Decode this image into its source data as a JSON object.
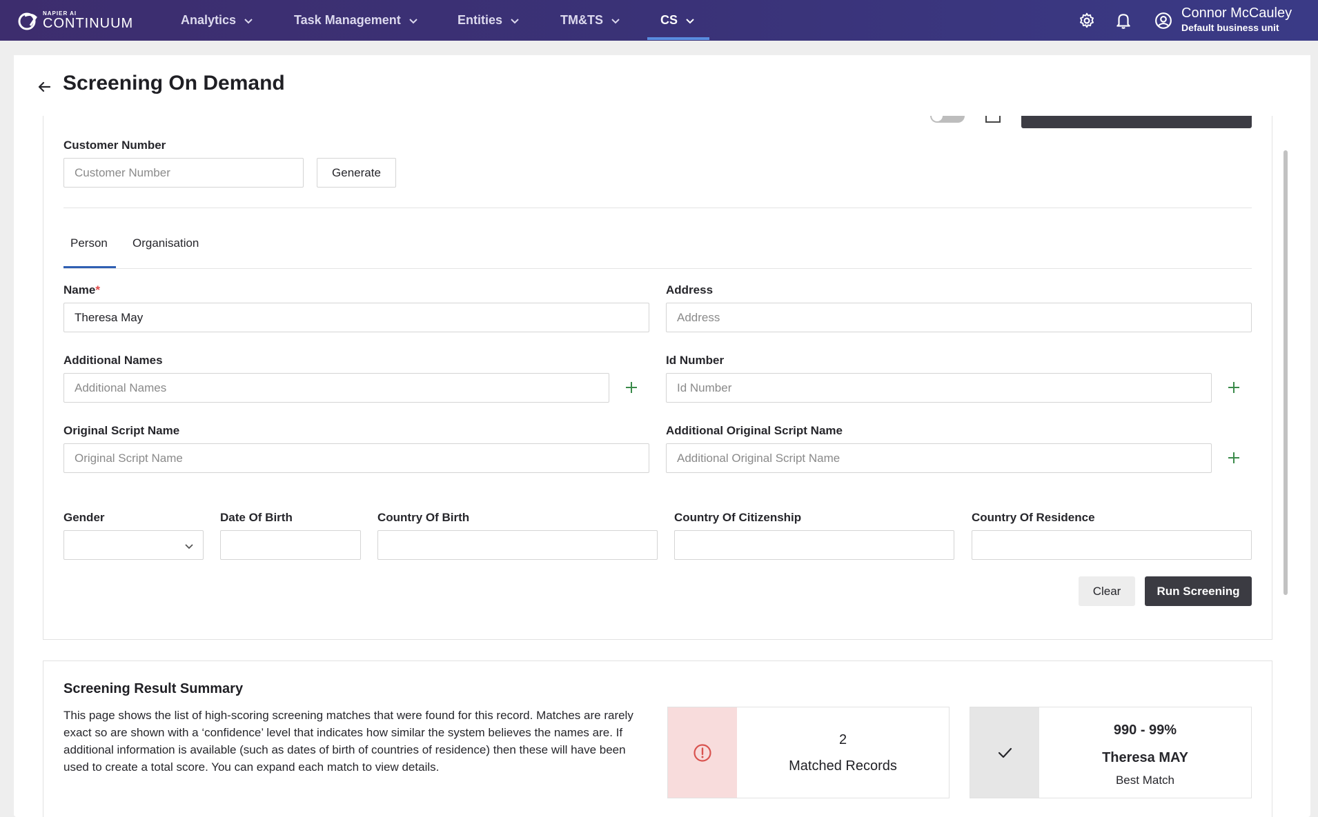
{
  "nav": {
    "logo_top": "NAPIER AI",
    "logo_bottom": "CONTINUUM",
    "items": [
      {
        "label": "Analytics"
      },
      {
        "label": "Task Management"
      },
      {
        "label": "Entities"
      },
      {
        "label": "TM&TS"
      },
      {
        "label": "CS"
      }
    ],
    "active": "CS",
    "user": {
      "name": "Connor McCauley",
      "unit": "Default business unit"
    }
  },
  "page": {
    "title": "Screening On Demand"
  },
  "customer": {
    "label": "Customer Number",
    "placeholder": "Customer Number",
    "generate_label": "Generate"
  },
  "tabs": [
    {
      "label": "Person",
      "active": true
    },
    {
      "label": "Organisation",
      "active": false
    }
  ],
  "form": {
    "name": {
      "label": "Name",
      "required_mark": "*",
      "value": "Theresa May"
    },
    "address": {
      "label": "Address",
      "placeholder": "Address"
    },
    "additional_names": {
      "label": "Additional Names",
      "placeholder": "Additional Names"
    },
    "id_number": {
      "label": "Id Number",
      "placeholder": "Id Number"
    },
    "original_script_name": {
      "label": "Original Script Name",
      "placeholder": "Original Script Name"
    },
    "additional_original_script_name": {
      "label": "Additional Original Script Name",
      "placeholder": "Additional Original Script Name"
    },
    "gender": {
      "label": "Gender",
      "value": ""
    },
    "date_of_birth": {
      "label": "Date Of Birth",
      "value": ""
    },
    "country_of_birth": {
      "label": "Country Of Birth",
      "value": ""
    },
    "country_of_citizenship": {
      "label": "Country Of Citizenship",
      "value": ""
    },
    "country_of_residence": {
      "label": "Country Of Residence",
      "value": ""
    },
    "clear_label": "Clear",
    "run_label": "Run Screening"
  },
  "summary": {
    "title": "Screening Result Summary",
    "text": "This page shows the list of high-scoring screening matches that were found for this record. Matches are rarely exact so are shown with a ‘confidence’ level that indicates how similar the system believes the names are. If additional information is available (such as dates of birth of countries of residence) then these will have been used to create a total score. You can expand each match to view details.",
    "matched": {
      "count": "2",
      "label": "Matched Records"
    },
    "best_match": {
      "range": "990 - 99%",
      "name": "Theresa MAY",
      "label": "Best Match"
    }
  },
  "colors": {
    "nav_bg": "#3d2d6e",
    "accent": "#2f5fb3",
    "plus": "#3a8a4a",
    "alert": "#d9534f",
    "run_button": "#3b3b42"
  }
}
